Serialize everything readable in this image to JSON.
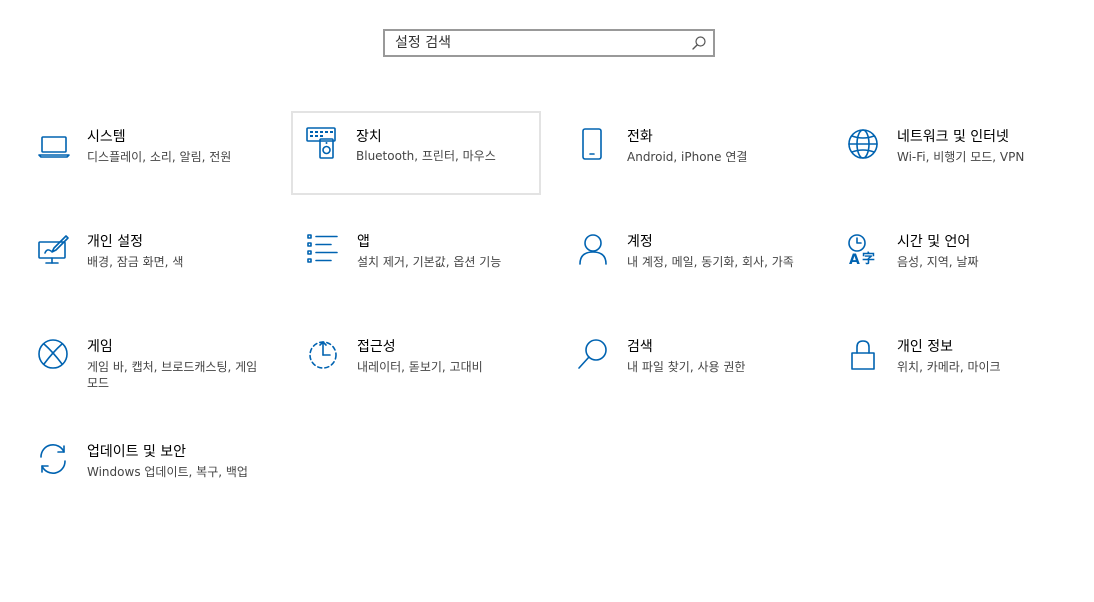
{
  "search": {
    "placeholder": "설정 검색"
  },
  "accent_color": "#0063b1",
  "tiles": [
    {
      "title": "시스템",
      "desc": "디스플레이, 소리, 알림, 전원",
      "icon": "laptop-icon"
    },
    {
      "title": "장치",
      "desc": "Bluetooth, 프린터, 마우스",
      "icon": "devices-icon"
    },
    {
      "title": "전화",
      "desc": "Android, iPhone 연결",
      "icon": "phone-icon"
    },
    {
      "title": "네트워크 및 인터넷",
      "desc": "Wi-Fi, 비행기 모드, VPN",
      "icon": "globe-icon"
    },
    {
      "title": "개인 설정",
      "desc": "배경, 잠금 화면, 색",
      "icon": "personalization-icon"
    },
    {
      "title": "앱",
      "desc": "설치 제거, 기본값, 옵션 기능",
      "icon": "apps-list-icon"
    },
    {
      "title": "계정",
      "desc": "내 계정, 메일, 동기화, 회사, 가족",
      "icon": "person-icon"
    },
    {
      "title": "시간 및 언어",
      "desc": "음성, 지역, 날짜",
      "icon": "time-language-icon"
    },
    {
      "title": "게임",
      "desc": "게임 바, 캡처, 브로드캐스팅, 게임 모드",
      "icon": "xbox-icon"
    },
    {
      "title": "접근성",
      "desc": "내레이터, 돋보기, 고대비",
      "icon": "accessibility-icon"
    },
    {
      "title": "검색",
      "desc": "내 파일 찾기, 사용 권한",
      "icon": "search-icon"
    },
    {
      "title": "개인 정보",
      "desc": "위치, 카메라, 마이크",
      "icon": "lock-icon"
    },
    {
      "title": "업데이트 및 보안",
      "desc": "Windows 업데이트, 복구, 백업",
      "icon": "sync-icon"
    }
  ]
}
